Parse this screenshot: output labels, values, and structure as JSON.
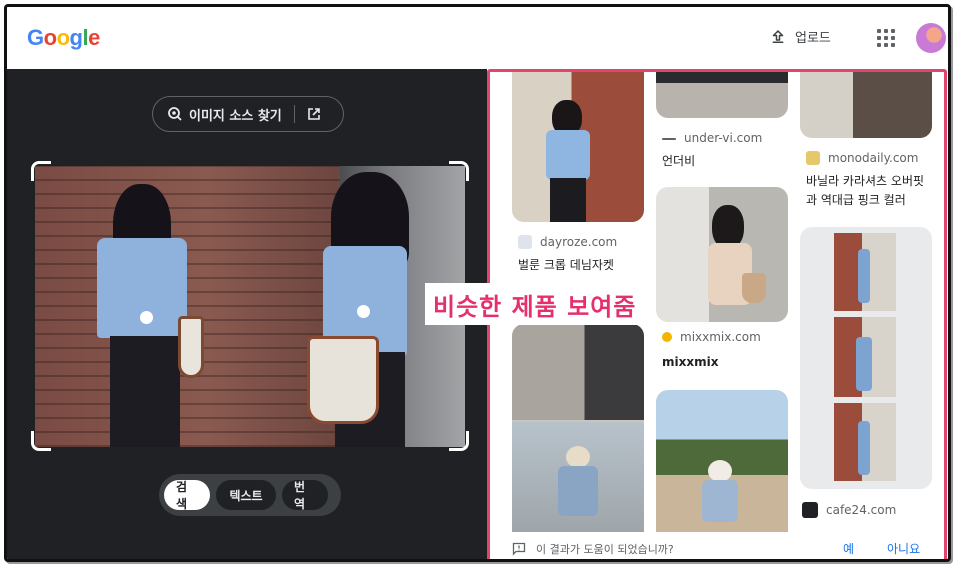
{
  "header": {
    "logo": [
      "G",
      "o",
      "o",
      "g",
      "l",
      "e"
    ],
    "logo_colors": [
      "#4285f4",
      "#ea4335",
      "#fbbc05",
      "#4285f4",
      "#34a853",
      "#ea4335"
    ],
    "upload_label": "업로드"
  },
  "left": {
    "source_button_label": "이미지 소스 찾기",
    "modes": [
      {
        "label": "검색",
        "active": true
      },
      {
        "label": "텍스트",
        "active": false
      },
      {
        "label": "번역",
        "active": false
      }
    ]
  },
  "results": {
    "col1": [
      {
        "site": "dayroze.com",
        "title": "벌룬 크롭 데님자켓",
        "fav_color": "#c5cad6"
      }
    ],
    "col2": [
      {
        "site": "under-vi.com",
        "title": "언더비",
        "fav_color": "#5f6368"
      },
      {
        "site": "mixxmix.com",
        "title": "mixxmix",
        "fav_color": "#f2b600"
      }
    ],
    "col3": [
      {
        "site": "monodaily.com",
        "title": "바닐라 카라셔츠 오버핏과 역대급 핑크 컬러",
        "fav_color": "#e5c86a"
      },
      {
        "site": "cafe24.com",
        "title": "",
        "fav_color": "#202124"
      }
    ]
  },
  "feedback": {
    "question": "이 결과가 도움이 되었습니까?",
    "yes": "예",
    "no": "아니요"
  },
  "overlay_caption": "비슷한 제품 보여줌",
  "colors": {
    "accent_border": "#e0456f",
    "caption_text": "#e6306b",
    "link_blue": "#1a73e8",
    "dark_bg": "#202124"
  }
}
